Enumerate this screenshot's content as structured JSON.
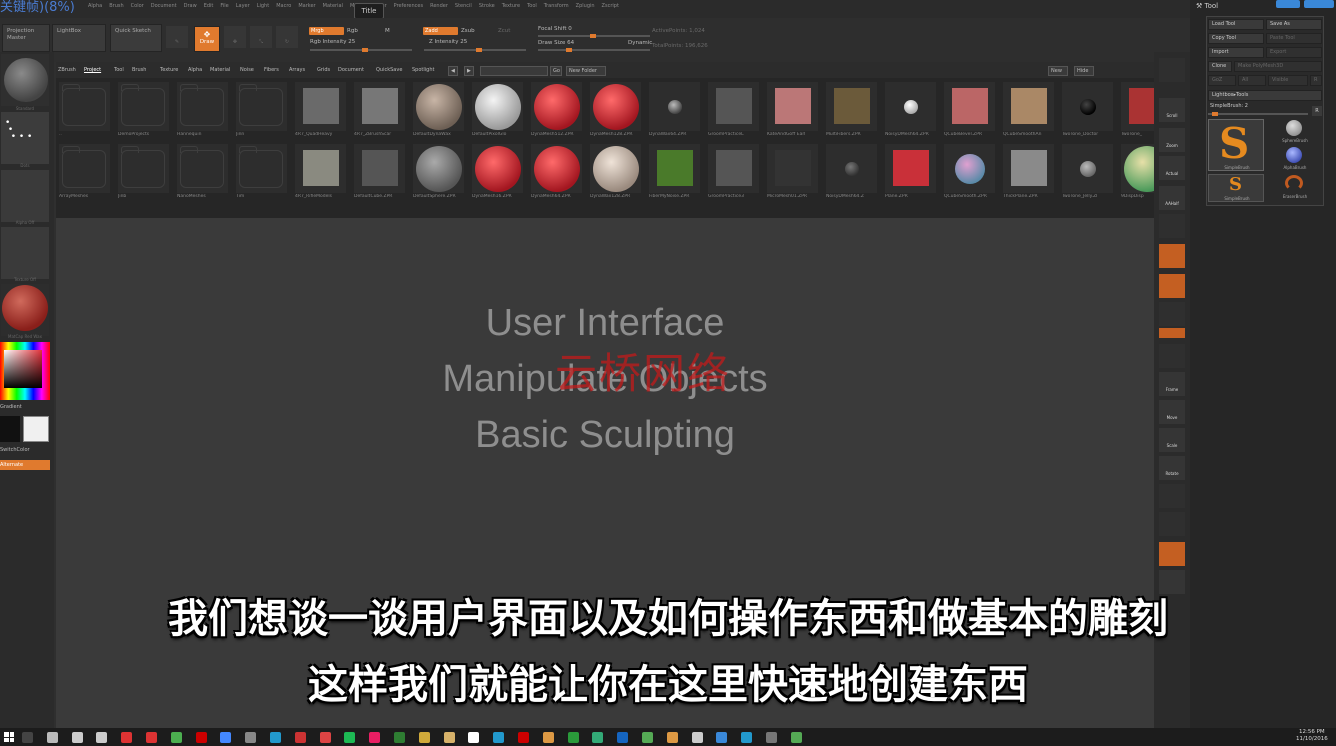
{
  "recording_title": "关键帧)(8%)",
  "menu_items": [
    "Alpha",
    "Brush",
    "Color",
    "Document",
    "Draw",
    "Edit",
    "File",
    "Layer",
    "Light",
    "Macro",
    "Marker",
    "Material",
    "Movie",
    "Picker",
    "Preferences",
    "Render",
    "Stencil",
    "Stroke",
    "Texture",
    "Tool",
    "Transform",
    "Zplugin",
    "Zscript"
  ],
  "title_tab": "Title",
  "toolbar": {
    "projection_master": "Projection Master",
    "lightbox": "LightBox",
    "quick_sketch": "Quick Sketch",
    "draw": "Draw",
    "mrgb": "Mrgb",
    "rgb": "Rgb",
    "m": "M",
    "rgb_intensity": "Rgb Intensity 25",
    "zadd": "Zadd",
    "zsub": "Zsub",
    "zcut": "Zcut",
    "z_intensity": "Z Intensity 25",
    "focal_shift": "Focal Shift 0",
    "draw_size": "Draw Size 64",
    "dynamic": "Dynamic",
    "active_points": "ActivePoints: 1,024",
    "total_points": "TotalPoints: 196,626"
  },
  "left_shelf": {
    "labels": [
      "Standard",
      "Dots",
      "Alpha Off",
      "Texture Off",
      "MatCap Red Wax"
    ],
    "gradient": "Gradient",
    "switch_color": "SwitchColor",
    "alternate": "Alternate"
  },
  "lightbox": {
    "tabs": [
      "ZBrush",
      "Project",
      "Tool",
      "Brush",
      "Texture",
      "Alpha",
      "Material",
      "Noise",
      "Fibers",
      "Arrays",
      "Grids",
      "Document",
      "QuickSave",
      "Spotlight"
    ],
    "active_tab": "Project",
    "go": "Go",
    "new_folder": "New Folder",
    "new": "New",
    "hide": "Hide",
    "row1": [
      "..",
      "DemoProjects",
      "Hannequin",
      "Jinn",
      "4R7_QuadHeavy",
      "4R7_ZBrushScar",
      "DefaultDynaWax",
      "DefaultPixolGlo",
      "DynaMesh512.ZPR",
      "DynaMesh128.ZPR",
      "DynaWax64.ZPR",
      "GroomPracticeL",
      "KateAndGoff Earl",
      "MultiFibers.ZPR",
      "NoisyDMesh64.ZPR",
      "QCubeBevel.ZPR",
      "QCubeSmoothAn",
      "TwoTone_Doctor",
      "TwoTone_"
    ],
    "row2": [
      "ArrayMeshes",
      "Jinb",
      "NanoMeshes",
      "Tim",
      "4R7_RifleModels",
      "DefaultCube.ZPR",
      "DefaultSphere.ZPR",
      "DynaMesh16.ZPR",
      "DynaMesh64.ZPR",
      "DynaWax128.ZPR",
      "FiberMyNoise.ZPR",
      "GroomPractice3",
      "MicroMesh01.ZPR",
      "NoisyDMesh64.Z",
      "Plane.ZPR",
      "QCubeSmooth.ZPR",
      "ThickPlane.ZPR",
      "TwoTone_Jelly.ZI",
      "9DispDisp"
    ]
  },
  "canvas_text": [
    "User Interface",
    "Manipulate Objects",
    "Basic Sculpting"
  ],
  "watermark": "云桥网络",
  "right_shelf": [
    "Scroll",
    "Zoom",
    "Actual",
    "AAHalf",
    "Frame",
    "Move",
    "Scale",
    "Rotate"
  ],
  "tool_panel": {
    "title": "Tool",
    "load_tool": "Load Tool",
    "save_as": "Save As",
    "copy_tool": "Copy Tool",
    "paste_tool": "Paste Tool",
    "import": "Import",
    "export": "Export",
    "clone": "Clone",
    "make_polymesh": "Make PolyMesh3D",
    "goz": "GoZ",
    "all": "All",
    "visible": "Visible",
    "r": "R",
    "lightbox_tools": "Lightbox▸Tools",
    "simplebrush": "SimpleBrush: 2",
    "tools": [
      "SimpleBrush",
      "SphereBrush",
      "AlphaBrush",
      "SimpleBrush",
      "EraserBrush"
    ]
  },
  "subtitles": [
    "我们想谈一谈用户界面以及如何操作东西和做基本的雕刻",
    "这样我们就能让你在这里快速地创建东西"
  ],
  "clock": {
    "time": "12:56 PM",
    "date": "11/10/2016"
  }
}
